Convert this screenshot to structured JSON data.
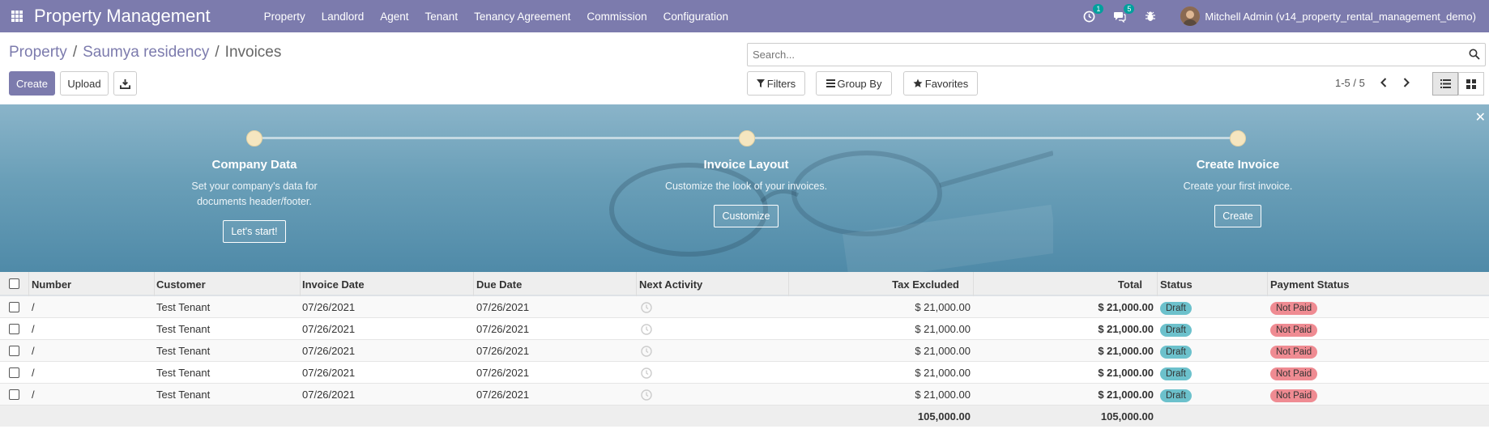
{
  "navbar": {
    "brand": "Property Management",
    "menu": [
      "Property",
      "Landlord",
      "Agent",
      "Tenant",
      "Tenancy Agreement",
      "Commission",
      "Configuration"
    ],
    "activity_count": "1",
    "messages_count": "5",
    "user": "Mitchell Admin (v14_property_rental_management_demo)"
  },
  "breadcrumb": {
    "parts": [
      "Property",
      "Saumya residency"
    ],
    "current": "Invoices",
    "separator": "/"
  },
  "toolbar": {
    "create": "Create",
    "upload": "Upload"
  },
  "search": {
    "placeholder": "Search..."
  },
  "filters": {
    "filters": "Filters",
    "group_by": "Group By",
    "favorites": "Favorites"
  },
  "pager": {
    "range": "1-5 / 5"
  },
  "banner": {
    "steps": [
      {
        "title": "Company Data",
        "desc": "Set your company's data for documents header/footer.",
        "button": "Let's start!"
      },
      {
        "title": "Invoice Layout",
        "desc": "Customize the look of your invoices.",
        "button": "Customize"
      },
      {
        "title": "Create Invoice",
        "desc": "Create your first invoice.",
        "button": "Create"
      }
    ]
  },
  "table": {
    "headers": {
      "number": "Number",
      "customer": "Customer",
      "invoice_date": "Invoice Date",
      "due_date": "Due Date",
      "next_activity": "Next Activity",
      "tax_excluded": "Tax Excluded",
      "total": "Total",
      "status": "Status",
      "payment_status": "Payment Status"
    },
    "rows": [
      {
        "number": "/",
        "customer": "Test Tenant",
        "invoice_date": "07/26/2021",
        "due_date": "07/26/2021",
        "tax_excluded": "$ 21,000.00",
        "total": "$ 21,000.00",
        "status": "Draft",
        "payment_status": "Not Paid"
      },
      {
        "number": "/",
        "customer": "Test Tenant",
        "invoice_date": "07/26/2021",
        "due_date": "07/26/2021",
        "tax_excluded": "$ 21,000.00",
        "total": "$ 21,000.00",
        "status": "Draft",
        "payment_status": "Not Paid"
      },
      {
        "number": "/",
        "customer": "Test Tenant",
        "invoice_date": "07/26/2021",
        "due_date": "07/26/2021",
        "tax_excluded": "$ 21,000.00",
        "total": "$ 21,000.00",
        "status": "Draft",
        "payment_status": "Not Paid"
      },
      {
        "number": "/",
        "customer": "Test Tenant",
        "invoice_date": "07/26/2021",
        "due_date": "07/26/2021",
        "tax_excluded": "$ 21,000.00",
        "total": "$ 21,000.00",
        "status": "Draft",
        "payment_status": "Not Paid"
      },
      {
        "number": "/",
        "customer": "Test Tenant",
        "invoice_date": "07/26/2021",
        "due_date": "07/26/2021",
        "tax_excluded": "$ 21,000.00",
        "total": "$ 21,000.00",
        "status": "Draft",
        "payment_status": "Not Paid"
      }
    ],
    "totals": {
      "tax_excluded": "105,000.00",
      "total": "105,000.00"
    }
  },
  "colors": {
    "brand": "#7c7bad",
    "badge": "#00a09d",
    "draft": "#6cc1cc",
    "not_paid": "#ef8b92"
  }
}
